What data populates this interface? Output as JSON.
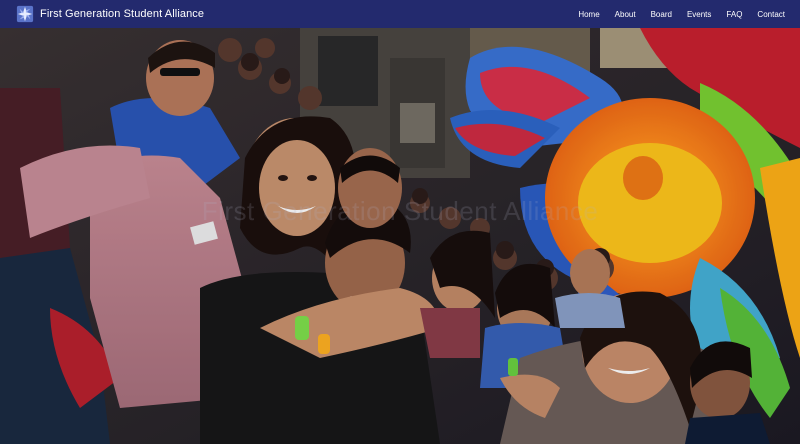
{
  "brand": {
    "name": "First Generation Student Alliance",
    "logo_icon": "compass-star-icon"
  },
  "nav": {
    "items": [
      {
        "label": "Home"
      },
      {
        "label": "About"
      },
      {
        "label": "Board"
      },
      {
        "label": "Events"
      },
      {
        "label": "FAQ"
      },
      {
        "label": "Contact"
      }
    ]
  },
  "hero": {
    "title": "First Generation Student Alliance"
  },
  "colors": {
    "navbar": "#232a6e",
    "nav_text": "#ffffff"
  }
}
